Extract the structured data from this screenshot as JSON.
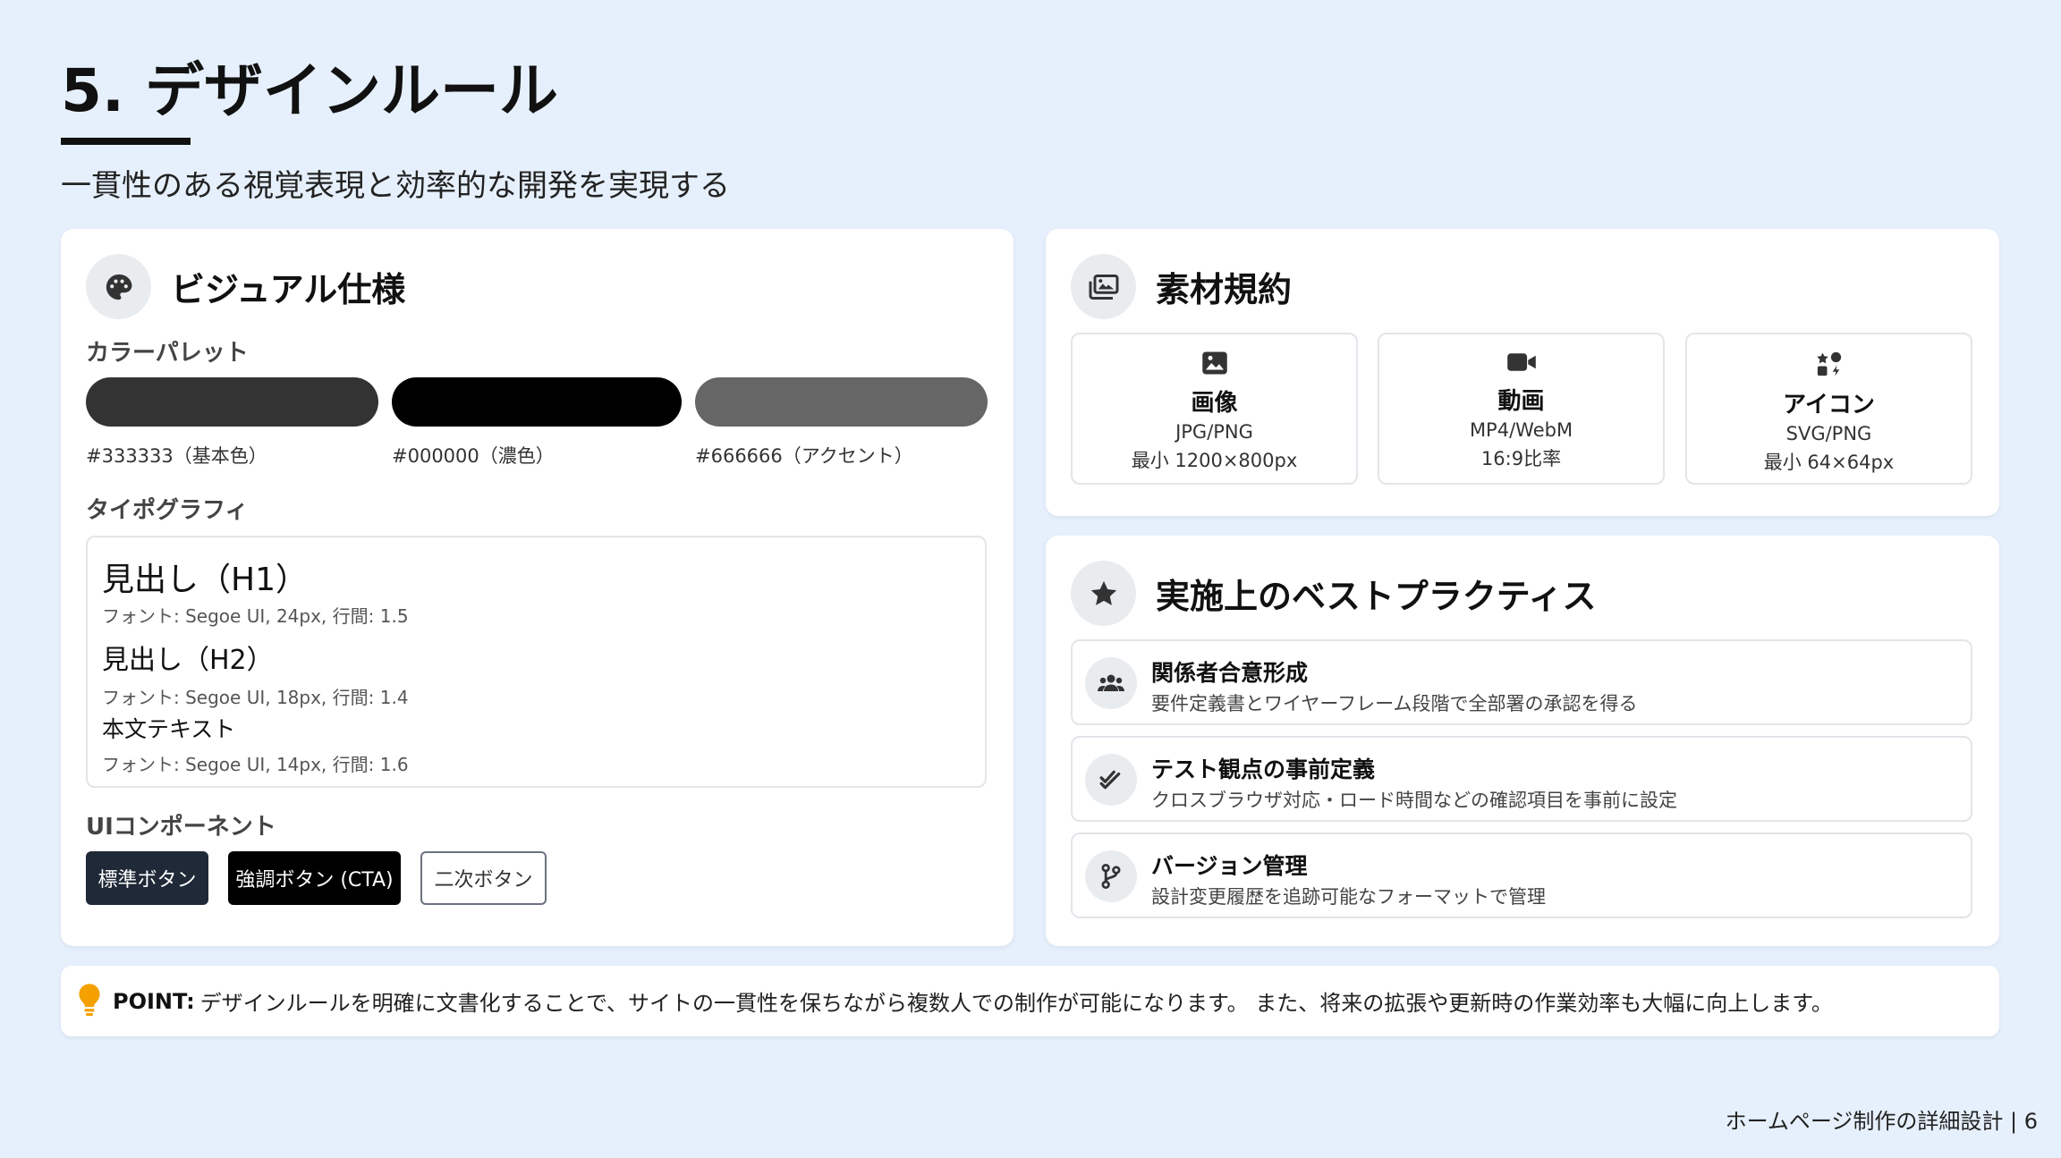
{
  "header": {
    "title": "5. デザインルール",
    "subtitle": "一貫性のある視覚表現と効率的な開発を実現する"
  },
  "visual": {
    "title": "ビジュアル仕様",
    "icon": "palette-icon",
    "palette_label": "カラーパレット",
    "swatches": [
      {
        "color": "#333333",
        "label": "#333333（基本色）"
      },
      {
        "color": "#000000",
        "label": "#000000（濃色）"
      },
      {
        "color": "#666666",
        "label": "#666666（アクセント）"
      }
    ],
    "typography_label": "タイポグラフィ",
    "typography": [
      {
        "sample": "見出し（H1）",
        "meta": "フォント: Segoe UI, 24px, 行間: 1.5"
      },
      {
        "sample": "見出し（H2）",
        "meta": "フォント: Segoe UI, 18px, 行間: 1.4"
      },
      {
        "sample": "本文テキスト",
        "meta": "フォント: Segoe UI, 14px, 行間: 1.6"
      }
    ],
    "ui_label": "UIコンポーネント",
    "buttons": {
      "standard": "標準ボタン",
      "cta": "強調ボタン (CTA)",
      "secondary": "二次ボタン"
    }
  },
  "assets": {
    "title": "素材規約",
    "icon": "images-icon",
    "items": [
      {
        "icon": "image-icon",
        "name": "画像",
        "format": "JPG/PNG",
        "spec": "最小 1200×800px"
      },
      {
        "icon": "video-icon",
        "name": "動画",
        "format": "MP4/WebM",
        "spec": "16:9比率"
      },
      {
        "icon": "icons-icon",
        "name": "アイコン",
        "format": "SVG/PNG",
        "spec": "最小 64×64px"
      }
    ]
  },
  "best": {
    "title": "実施上のベストプラクティス",
    "icon": "star-icon",
    "items": [
      {
        "icon": "users-icon",
        "title": "関係者合意形成",
        "desc": "要件定義書とワイヤーフレーム段階で全部署の承認を得る"
      },
      {
        "icon": "check-double-icon",
        "title": "テスト観点の事前定義",
        "desc": "クロスブラウザ対応・ロード時間などの確認項目を事前に設定"
      },
      {
        "icon": "branch-icon",
        "title": "バージョン管理",
        "desc": "設計変更履歴を追跡可能なフォーマットで管理"
      }
    ]
  },
  "point": {
    "icon": "lightbulb-icon",
    "label": "POINT:",
    "text": "デザインルールを明確に文書化することで、サイトの一貫性を保ちながら複数人での制作が可能になります。 また、将来の拡張や更新時の作業効率も大幅に向上します。"
  },
  "footer": {
    "text": "ホームページ制作の詳細設計 | 6"
  }
}
